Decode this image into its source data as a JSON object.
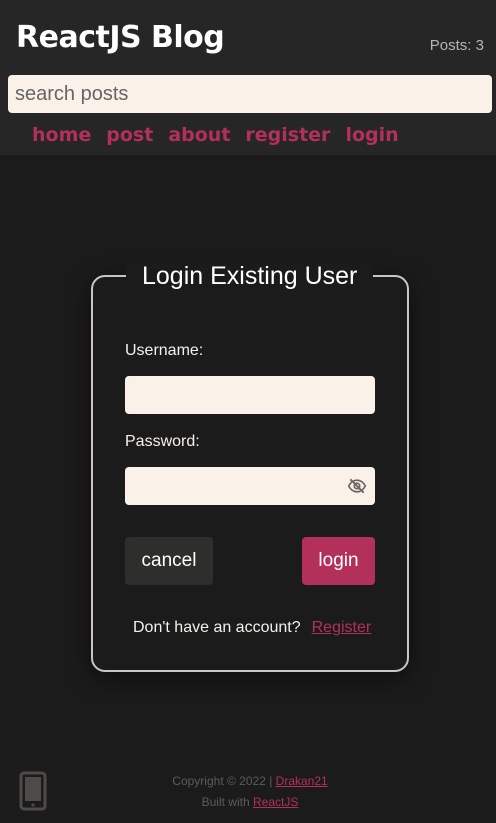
{
  "header": {
    "app_title": "ReactJS Blog",
    "post_count": "Posts: 3",
    "search_placeholder": "search posts",
    "nav": [
      "home",
      "post",
      "about",
      "register",
      "login"
    ]
  },
  "login_form": {
    "legend": "Login Existing User",
    "username_label": "Username:",
    "password_label": "Password:",
    "cancel_label": "cancel",
    "login_label": "login",
    "no_account_text": "Don't have an account?",
    "register_link": "Register"
  },
  "footer": {
    "copyright_text": "Copyright © 2022 |",
    "author_link": "Drakan21",
    "built_with_text": "Built with",
    "built_with_link": "ReactJS"
  },
  "icons": {
    "password_toggle": "eye-slash-icon",
    "device": "phone-icon"
  },
  "colors": {
    "accent": "#b3305b",
    "background": "#1c1b1b",
    "header_background": "#272626",
    "input_background": "#faf1e8"
  }
}
